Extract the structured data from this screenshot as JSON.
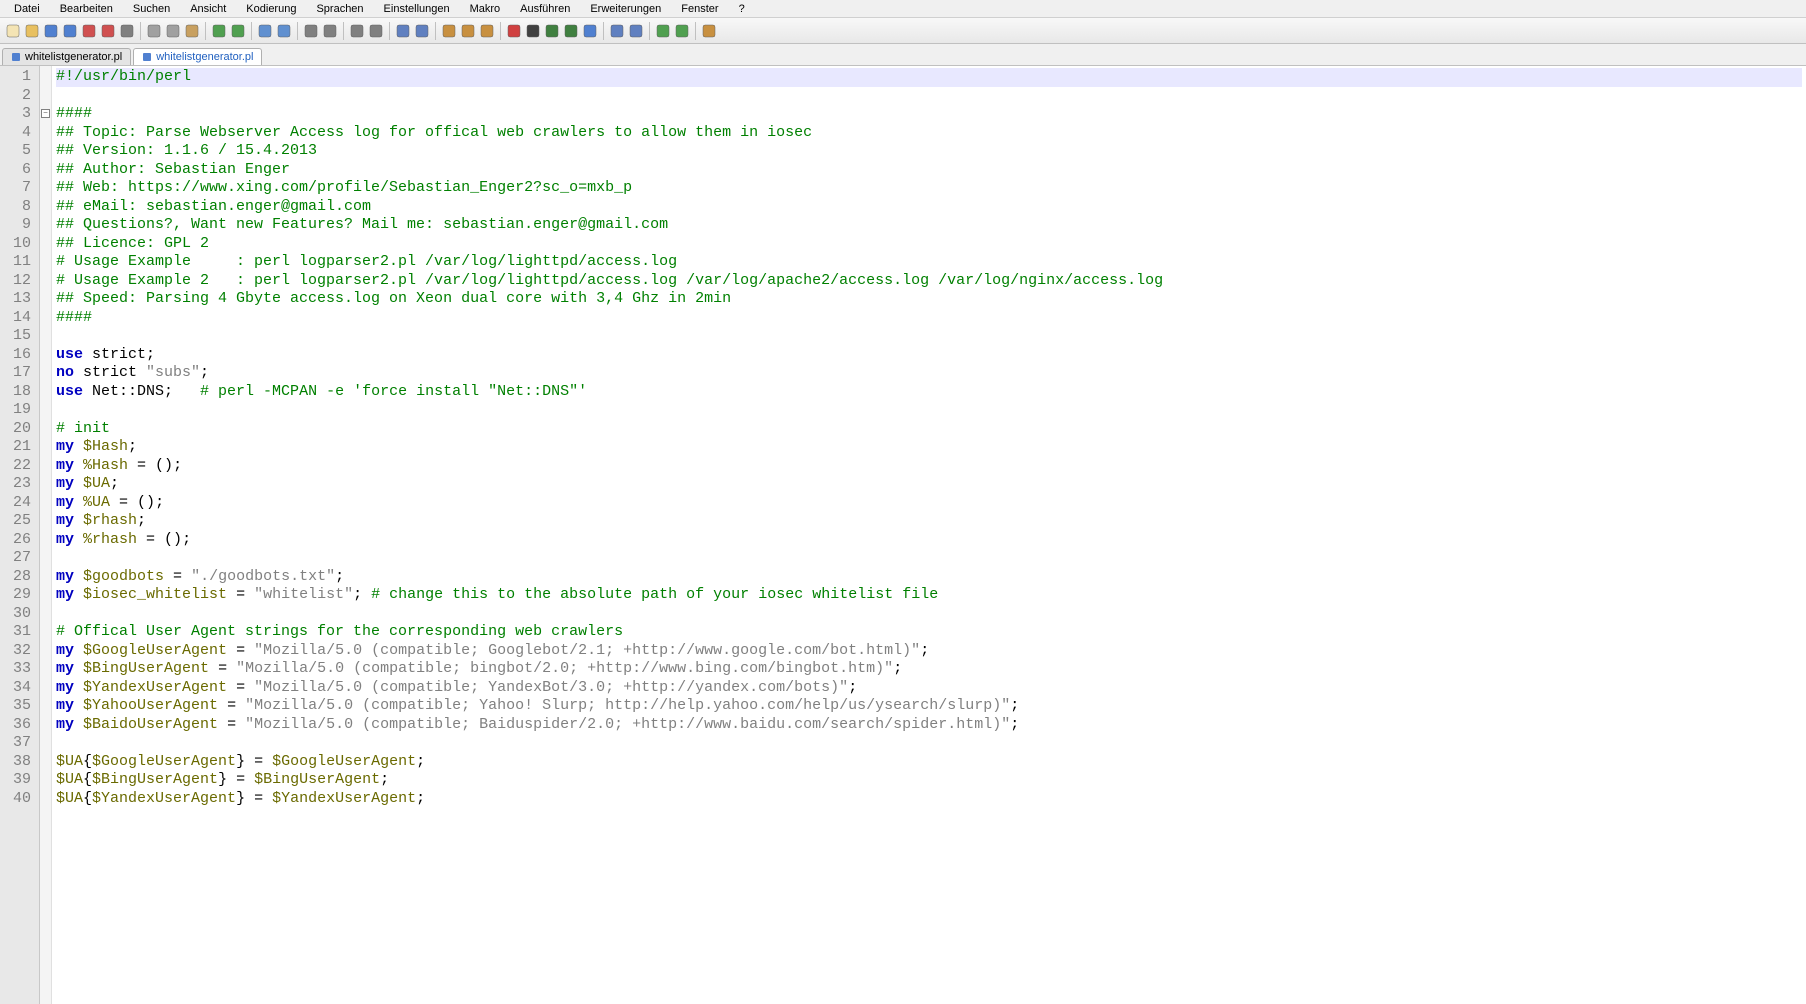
{
  "menu": [
    "Datei",
    "Bearbeiten",
    "Suchen",
    "Ansicht",
    "Kodierung",
    "Sprachen",
    "Einstellungen",
    "Makro",
    "Ausführen",
    "Erweiterungen",
    "Fenster",
    "?"
  ],
  "tabs": [
    {
      "label": "whitelistgenerator.pl",
      "active": false
    },
    {
      "label": "whitelistgenerator.pl",
      "active": true
    }
  ],
  "code": {
    "lines": [
      {
        "n": 1,
        "current": true,
        "fold": null,
        "tokens": [
          {
            "t": "#!/usr/bin/perl",
            "c": "c-comment"
          }
        ]
      },
      {
        "n": 2,
        "tokens": []
      },
      {
        "n": 3,
        "fold": "minus",
        "tokens": [
          {
            "t": "####",
            "c": "c-comment"
          }
        ]
      },
      {
        "n": 4,
        "tokens": [
          {
            "t": "## Topic: Parse Webserver Access log for offical web crawlers to allow them in iosec",
            "c": "c-comment"
          }
        ]
      },
      {
        "n": 5,
        "tokens": [
          {
            "t": "## Version: 1.1.6 / 15.4.2013",
            "c": "c-comment"
          }
        ]
      },
      {
        "n": 6,
        "tokens": [
          {
            "t": "## Author: Sebastian Enger",
            "c": "c-comment"
          }
        ]
      },
      {
        "n": 7,
        "tokens": [
          {
            "t": "## Web: https://www.xing.com/profile/Sebastian_Enger2?sc_o=mxb_p",
            "c": "c-comment"
          }
        ]
      },
      {
        "n": 8,
        "tokens": [
          {
            "t": "## eMail: sebastian.enger@gmail.com",
            "c": "c-comment"
          }
        ]
      },
      {
        "n": 9,
        "tokens": [
          {
            "t": "## Questions?, Want new Features? Mail me: sebastian.enger@gmail.com",
            "c": "c-comment"
          }
        ]
      },
      {
        "n": 10,
        "tokens": [
          {
            "t": "## Licence: GPL 2",
            "c": "c-comment"
          }
        ]
      },
      {
        "n": 11,
        "tokens": [
          {
            "t": "# Usage Example     : perl logparser2.pl /var/log/lighttpd/access.log",
            "c": "c-comment"
          }
        ]
      },
      {
        "n": 12,
        "tokens": [
          {
            "t": "# Usage Example 2   : perl logparser2.pl /var/log/lighttpd/access.log /var/log/apache2/access.log /var/log/nginx/access.log",
            "c": "c-comment"
          }
        ]
      },
      {
        "n": 13,
        "tokens": [
          {
            "t": "## Speed: Parsing 4 Gbyte access.log on Xeon dual core with 3,4 Ghz in 2min",
            "c": "c-comment"
          }
        ]
      },
      {
        "n": 14,
        "tokens": [
          {
            "t": "####",
            "c": "c-comment"
          }
        ]
      },
      {
        "n": 15,
        "tokens": []
      },
      {
        "n": 16,
        "tokens": [
          {
            "t": "use",
            "c": "c-keyword"
          },
          {
            "t": " strict",
            "c": "c-plain"
          },
          {
            "t": ";",
            "c": "c-plain"
          }
        ]
      },
      {
        "n": 17,
        "tokens": [
          {
            "t": "no",
            "c": "c-keyword"
          },
          {
            "t": " strict ",
            "c": "c-plain"
          },
          {
            "t": "\"subs\"",
            "c": "c-string"
          },
          {
            "t": ";",
            "c": "c-plain"
          }
        ]
      },
      {
        "n": 18,
        "tokens": [
          {
            "t": "use",
            "c": "c-keyword"
          },
          {
            "t": " Net::DNS",
            "c": "c-plain"
          },
          {
            "t": ";   ",
            "c": "c-plain"
          },
          {
            "t": "# perl -MCPAN -e 'force install \"Net::DNS\"'",
            "c": "c-comment"
          }
        ]
      },
      {
        "n": 19,
        "tokens": []
      },
      {
        "n": 20,
        "tokens": [
          {
            "t": "# init",
            "c": "c-comment"
          }
        ]
      },
      {
        "n": 21,
        "tokens": [
          {
            "t": "my",
            "c": "c-keyword"
          },
          {
            "t": " ",
            "c": "c-plain"
          },
          {
            "t": "$Hash",
            "c": "c-var"
          },
          {
            "t": ";",
            "c": "c-plain"
          }
        ]
      },
      {
        "n": 22,
        "tokens": [
          {
            "t": "my",
            "c": "c-keyword"
          },
          {
            "t": " ",
            "c": "c-plain"
          },
          {
            "t": "%Hash",
            "c": "c-var"
          },
          {
            "t": " = ()",
            "c": "c-plain"
          },
          {
            "t": ";",
            "c": "c-plain"
          }
        ]
      },
      {
        "n": 23,
        "tokens": [
          {
            "t": "my",
            "c": "c-keyword"
          },
          {
            "t": " ",
            "c": "c-plain"
          },
          {
            "t": "$UA",
            "c": "c-var"
          },
          {
            "t": ";",
            "c": "c-plain"
          }
        ]
      },
      {
        "n": 24,
        "tokens": [
          {
            "t": "my",
            "c": "c-keyword"
          },
          {
            "t": " ",
            "c": "c-plain"
          },
          {
            "t": "%UA",
            "c": "c-var"
          },
          {
            "t": " = ()",
            "c": "c-plain"
          },
          {
            "t": ";",
            "c": "c-plain"
          }
        ]
      },
      {
        "n": 25,
        "tokens": [
          {
            "t": "my",
            "c": "c-keyword"
          },
          {
            "t": " ",
            "c": "c-plain"
          },
          {
            "t": "$rhash",
            "c": "c-var"
          },
          {
            "t": ";",
            "c": "c-plain"
          }
        ]
      },
      {
        "n": 26,
        "tokens": [
          {
            "t": "my",
            "c": "c-keyword"
          },
          {
            "t": " ",
            "c": "c-plain"
          },
          {
            "t": "%rhash",
            "c": "c-var"
          },
          {
            "t": " = ()",
            "c": "c-plain"
          },
          {
            "t": ";",
            "c": "c-plain"
          }
        ]
      },
      {
        "n": 27,
        "tokens": []
      },
      {
        "n": 28,
        "tokens": [
          {
            "t": "my",
            "c": "c-keyword"
          },
          {
            "t": " ",
            "c": "c-plain"
          },
          {
            "t": "$goodbots",
            "c": "c-var"
          },
          {
            "t": " = ",
            "c": "c-plain"
          },
          {
            "t": "\"./goodbots.txt\"",
            "c": "c-string"
          },
          {
            "t": ";",
            "c": "c-plain"
          }
        ]
      },
      {
        "n": 29,
        "tokens": [
          {
            "t": "my",
            "c": "c-keyword"
          },
          {
            "t": " ",
            "c": "c-plain"
          },
          {
            "t": "$iosec_whitelist",
            "c": "c-var"
          },
          {
            "t": " = ",
            "c": "c-plain"
          },
          {
            "t": "\"whitelist\"",
            "c": "c-string"
          },
          {
            "t": "; ",
            "c": "c-plain"
          },
          {
            "t": "# change this to the absolute path of your iosec whitelist file",
            "c": "c-comment"
          }
        ]
      },
      {
        "n": 30,
        "tokens": []
      },
      {
        "n": 31,
        "tokens": [
          {
            "t": "# Offical User Agent strings for the corresponding web crawlers",
            "c": "c-comment"
          }
        ]
      },
      {
        "n": 32,
        "tokens": [
          {
            "t": "my",
            "c": "c-keyword"
          },
          {
            "t": " ",
            "c": "c-plain"
          },
          {
            "t": "$GoogleUserAgent",
            "c": "c-var"
          },
          {
            "t": " = ",
            "c": "c-plain"
          },
          {
            "t": "\"Mozilla/5.0 (compatible; Googlebot/2.1; +http://www.google.com/bot.html)\"",
            "c": "c-string"
          },
          {
            "t": ";",
            "c": "c-plain"
          }
        ]
      },
      {
        "n": 33,
        "tokens": [
          {
            "t": "my",
            "c": "c-keyword"
          },
          {
            "t": " ",
            "c": "c-plain"
          },
          {
            "t": "$BingUserAgent",
            "c": "c-var"
          },
          {
            "t": " = ",
            "c": "c-plain"
          },
          {
            "t": "\"Mozilla/5.0 (compatible; bingbot/2.0; +http://www.bing.com/bingbot.htm)\"",
            "c": "c-string"
          },
          {
            "t": ";",
            "c": "c-plain"
          }
        ]
      },
      {
        "n": 34,
        "tokens": [
          {
            "t": "my",
            "c": "c-keyword"
          },
          {
            "t": " ",
            "c": "c-plain"
          },
          {
            "t": "$YandexUserAgent",
            "c": "c-var"
          },
          {
            "t": " = ",
            "c": "c-plain"
          },
          {
            "t": "\"Mozilla/5.0 (compatible; YandexBot/3.0; +http://yandex.com/bots)\"",
            "c": "c-string"
          },
          {
            "t": ";",
            "c": "c-plain"
          }
        ]
      },
      {
        "n": 35,
        "tokens": [
          {
            "t": "my",
            "c": "c-keyword"
          },
          {
            "t": " ",
            "c": "c-plain"
          },
          {
            "t": "$YahooUserAgent",
            "c": "c-var"
          },
          {
            "t": " = ",
            "c": "c-plain"
          },
          {
            "t": "\"Mozilla/5.0 (compatible; Yahoo! Slurp; http://help.yahoo.com/help/us/ysearch/slurp)\"",
            "c": "c-string"
          },
          {
            "t": ";",
            "c": "c-plain"
          }
        ]
      },
      {
        "n": 36,
        "tokens": [
          {
            "t": "my",
            "c": "c-keyword"
          },
          {
            "t": " ",
            "c": "c-plain"
          },
          {
            "t": "$BaidoUserAgent",
            "c": "c-var"
          },
          {
            "t": " = ",
            "c": "c-plain"
          },
          {
            "t": "\"Mozilla/5.0 (compatible; Baiduspider/2.0; +http://www.baidu.com/search/spider.html)\"",
            "c": "c-string"
          },
          {
            "t": ";",
            "c": "c-plain"
          }
        ]
      },
      {
        "n": 37,
        "tokens": []
      },
      {
        "n": 38,
        "tokens": [
          {
            "t": "$UA",
            "c": "c-var"
          },
          {
            "t": "{",
            "c": "c-plain"
          },
          {
            "t": "$GoogleUserAgent",
            "c": "c-var"
          },
          {
            "t": "} = ",
            "c": "c-plain"
          },
          {
            "t": "$GoogleUserAgent",
            "c": "c-var"
          },
          {
            "t": ";",
            "c": "c-plain"
          }
        ]
      },
      {
        "n": 39,
        "tokens": [
          {
            "t": "$UA",
            "c": "c-var"
          },
          {
            "t": "{",
            "c": "c-plain"
          },
          {
            "t": "$BingUserAgent",
            "c": "c-var"
          },
          {
            "t": "} = ",
            "c": "c-plain"
          },
          {
            "t": "$BingUserAgent",
            "c": "c-var"
          },
          {
            "t": ";",
            "c": "c-plain"
          }
        ]
      },
      {
        "n": 40,
        "tokens": [
          {
            "t": "$UA",
            "c": "c-var"
          },
          {
            "t": "{",
            "c": "c-plain"
          },
          {
            "t": "$YandexUserAgent",
            "c": "c-var"
          },
          {
            "t": "} = ",
            "c": "c-plain"
          },
          {
            "t": "$YandexUserAgent",
            "c": "c-var"
          },
          {
            "t": ";",
            "c": "c-plain"
          }
        ]
      }
    ]
  },
  "toolbar_icons": [
    "new-file-icon",
    "open-file-icon",
    "save-icon",
    "save-all-icon",
    "close-icon",
    "close-all-icon",
    "print-icon",
    "sep",
    "cut-icon",
    "copy-icon",
    "paste-icon",
    "sep",
    "undo-icon",
    "redo-icon",
    "sep",
    "find-icon",
    "replace-icon",
    "sep",
    "zoom-in-icon",
    "zoom-out-icon",
    "sep",
    "sync-scroll-icon",
    "wrap-icon",
    "sep",
    "show-all-chars-icon",
    "indent-guide-icon",
    "sep",
    "folder-tree-icon",
    "function-list-icon",
    "doc-map-icon",
    "sep",
    "record-macro-icon",
    "stop-macro-icon",
    "play-macro-icon",
    "play-multi-icon",
    "save-macro-icon",
    "sep",
    "indent-less-icon",
    "indent-more-icon",
    "sep",
    "toggle-comment-icon",
    "block-comment-icon",
    "sep",
    "plugin-icon"
  ]
}
